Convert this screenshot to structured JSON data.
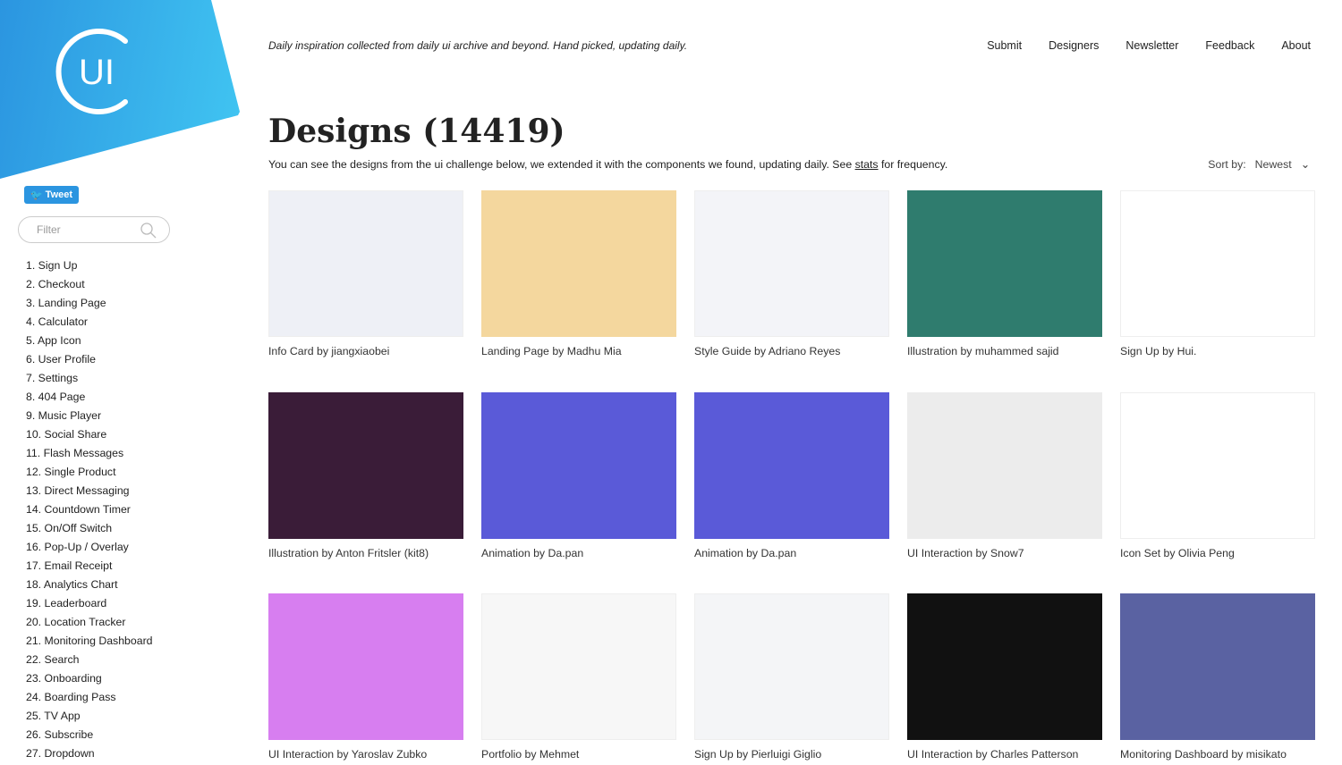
{
  "brand": {
    "logo_text": "UI",
    "accent": "#2b95e0"
  },
  "sidebar": {
    "tweet_label": "Tweet",
    "filter_placeholder": "Filter",
    "items": [
      "1. Sign Up",
      "2. Checkout",
      "3. Landing Page",
      "4. Calculator",
      "5. App Icon",
      "6. User Profile",
      "7. Settings",
      "8. 404 Page",
      "9. Music Player",
      "10. Social Share",
      "11. Flash Messages",
      "12. Single Product",
      "13. Direct Messaging",
      "14. Countdown Timer",
      "15. On/Off Switch",
      "16. Pop-Up / Overlay",
      "17. Email Receipt",
      "18. Analytics Chart",
      "19. Leaderboard",
      "20. Location Tracker",
      "21. Monitoring Dashboard",
      "22. Search",
      "23. Onboarding",
      "24. Boarding Pass",
      "25. TV App",
      "26. Subscribe",
      "27. Dropdown"
    ]
  },
  "header": {
    "tagline": "Daily inspiration collected from daily ui archive and beyond. Hand picked, updating daily.",
    "nav": [
      "Submit",
      "Designers",
      "Newsletter",
      "Feedback",
      "About"
    ]
  },
  "main": {
    "title": "Designs (14419)",
    "subtitle_pre": "You can see the designs from the ui challenge below, we extended it with the components we found, updating daily. See ",
    "subtitle_link": "stats",
    "subtitle_post": " for frequency.",
    "sort_label": "Sort by:",
    "sort_value": "Newest",
    "designs": [
      {
        "caption": "Info Card by jiangxiaobei",
        "color": "#eef0f6"
      },
      {
        "caption": "Landing Page by Madhu Mia",
        "color": "#f4d79e"
      },
      {
        "caption": "Style Guide by Adriano Reyes",
        "color": "#f3f4f8"
      },
      {
        "caption": "Illustration by muhammed sajid",
        "color": "#2f7c6e"
      },
      {
        "caption": "Sign Up by Hui.",
        "color": "#ffffff"
      },
      {
        "caption": "Illustration by Anton Fritsler (kit8)",
        "color": "#3a1c38"
      },
      {
        "caption": "Animation by Da.pan",
        "color": "#5a5ad8"
      },
      {
        "caption": "Animation by Da.pan",
        "color": "#5a5ad8"
      },
      {
        "caption": "UI Interaction by Snow7",
        "color": "#ececec"
      },
      {
        "caption": "Icon Set by Olivia Peng",
        "color": "#ffffff"
      },
      {
        "caption": "UI Interaction by Yaroslav Zubko",
        "color": "#d77ef0"
      },
      {
        "caption": "Portfolio by Mehmet",
        "color": "#f7f7f7"
      },
      {
        "caption": "Sign Up by Pierluigi Giglio",
        "color": "#f4f5f7"
      },
      {
        "caption": "UI Interaction by Charles Patterson",
        "color": "#111111"
      },
      {
        "caption": "Monitoring Dashboard by misikato",
        "color": "#5a62a2"
      }
    ]
  }
}
